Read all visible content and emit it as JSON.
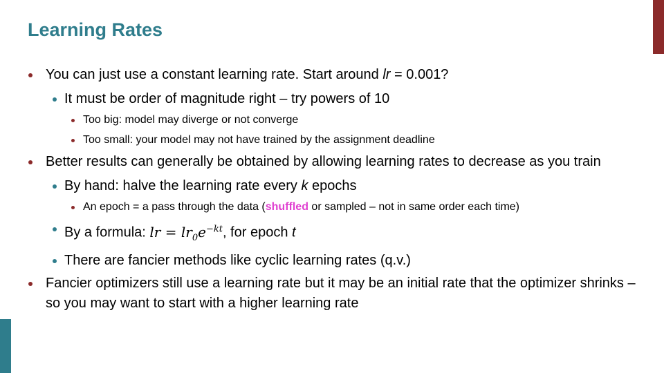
{
  "title": "Learning Rates",
  "b1": {
    "text_a": "You can just use a constant learning rate. Start around ",
    "lr": "lr",
    "text_b": " = 0.001?"
  },
  "b1_1": "It must be order of magnitude right – try powers of 10",
  "b1_1_1": "Too big: model may diverge or not converge",
  "b1_1_2": "Too small: your model may not have trained by the assignment deadline",
  "b2": "Better results can generally be obtained by allowing learning rates to decrease as you train",
  "b2_1": {
    "text_a": "By hand: halve the learning rate every ",
    "k": "k",
    "text_b": " epochs"
  },
  "b2_1_1": {
    "text_a": "An epoch = a pass through the data (",
    "shuffled": "shuffled",
    "text_b": " or sampled – not in same order each time)"
  },
  "b2_2": {
    "text_a": "By a formula: ",
    "lhs": "lr",
    "eq": " = ",
    "rhs": "lr",
    "sub": "0",
    "e": "e",
    "sup": "−kt",
    "text_b": ", for epoch ",
    "t": "t"
  },
  "b2_3": "There are fancier methods like cyclic learning rates (q.v.)",
  "b3": "Fancier optimizers still use a learning rate but it may be an initial rate that the optimizer shrinks – so you may want to start with a higher learning rate",
  "colors": {
    "title": "#2f7d8c",
    "accent_red": "#8b2a2a",
    "accent_teal": "#2f7d8c",
    "highlight": "#e040d0"
  }
}
